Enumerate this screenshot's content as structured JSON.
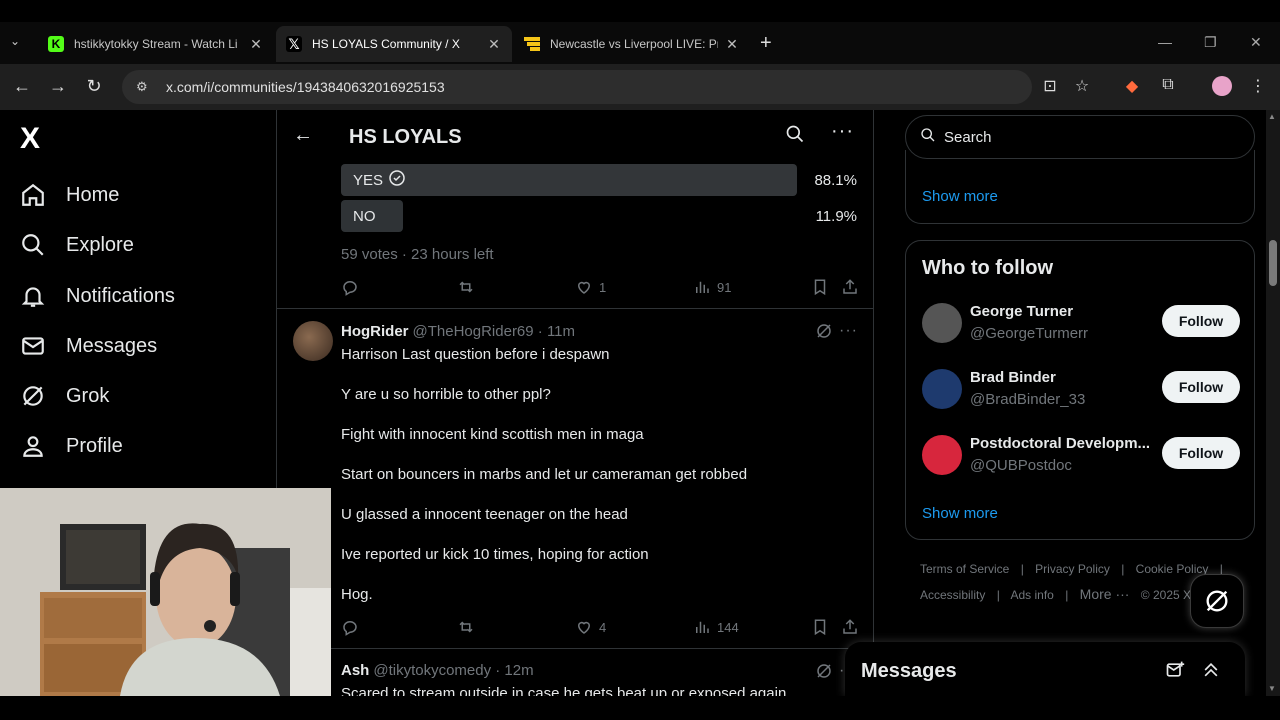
{
  "browser": {
    "tabs": [
      {
        "title": "hstikkytokky Stream - Watch Li",
        "favicon_color": "#53fc18",
        "favicon_letter": "K",
        "active": false
      },
      {
        "title": "HS LOYALS Community / X",
        "favicon_color": "#000000",
        "favicon_letter": "𝕏",
        "active": true
      },
      {
        "title": "Newcastle vs Liverpool LIVE: Pr",
        "favicon_color": "#f5c518",
        "favicon_letter": "",
        "active": false
      }
    ],
    "url": "x.com/i/communities/1943840632016925153",
    "new_tab": "+"
  },
  "nav": {
    "logo": "X",
    "items": [
      {
        "label": "Home",
        "icon": "home-icon"
      },
      {
        "label": "Explore",
        "icon": "search-icon"
      },
      {
        "label": "Notifications",
        "icon": "bell-icon"
      },
      {
        "label": "Messages",
        "icon": "mail-icon"
      },
      {
        "label": "Grok",
        "icon": "grok-icon"
      },
      {
        "label": "Profile",
        "icon": "person-icon"
      }
    ]
  },
  "community": {
    "name": "HS LOYALS"
  },
  "poll": {
    "options": [
      {
        "label": "YES",
        "percent": "88.1%",
        "fraction": 0.881,
        "winner": true
      },
      {
        "label": "NO",
        "percent": "11.9%",
        "fraction": 0.119,
        "winner": false
      }
    ],
    "meta": "59 votes · 23 hours left",
    "likes": "1",
    "views": "91"
  },
  "tweet": {
    "name": "HogRider",
    "handle": "@TheHogRider69 · 11m",
    "lines": [
      "Harrison Last question before i despawn",
      "Y are u so horrible to other ppl?",
      "Fight with innocent kind scottish men in maga",
      "Start on bouncers in marbs and let ur cameraman get robbed",
      "U glassed a innocent teenager on the head",
      "Ive reported ur kick 10 times, hoping for action",
      "Hog."
    ],
    "likes": "4",
    "views": "144"
  },
  "tweet2": {
    "name": "Ash",
    "handle": "@tikytokycomedy · 12m",
    "line": "Scared to stream outside in case he gets beat up or exposed again"
  },
  "right": {
    "search_placeholder": "Search",
    "show_more": "Show more",
    "who_to_follow": "Who to follow",
    "follow_label": "Follow",
    "suggestions": [
      {
        "name": "George Turner",
        "handle": "@GeorgeTurmerr",
        "avatar_color": "#555555"
      },
      {
        "name": "Brad Binder",
        "handle": "@BradBinder_33",
        "avatar_color": "#1e3a6e"
      },
      {
        "name": "Postdoctoral Developm...",
        "handle": "@QUBPostdoc",
        "avatar_color": "#d7263d"
      }
    ],
    "footer": {
      "row1": [
        "Terms of Service",
        "|",
        "Privacy Policy",
        "|",
        "Cookie Policy",
        "|"
      ],
      "row2": [
        "Accessibility",
        "|",
        "Ads info",
        "|",
        "More ···",
        "© 2025 X C"
      ]
    }
  },
  "messages_drawer": {
    "title": "Messages"
  }
}
